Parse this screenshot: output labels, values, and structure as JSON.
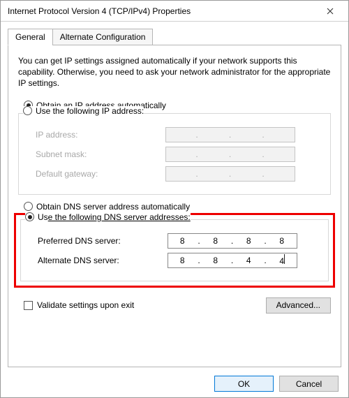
{
  "window": {
    "title": "Internet Protocol Version 4 (TCP/IPv4) Properties"
  },
  "tabs": {
    "general": "General",
    "alternate": "Alternate Configuration"
  },
  "intro": "You can get IP settings assigned automatically if your network supports this capability. Otherwise, you need to ask your network administrator for the appropriate IP settings.",
  "ip": {
    "auto_pre": "O",
    "auto_rest": "btain an IP address automatically",
    "manual_pre": "U",
    "manual_rest": "se the following IP address:",
    "address_pre": "I",
    "address_rest": "P address:",
    "subnet_pre": "S",
    "subnet_rest": "ubnet mask:",
    "gateway_pre": "D",
    "gateway_rest": "efault gateway:"
  },
  "ip_selected": "auto",
  "dns": {
    "auto_pre": "O",
    "auto_rest": "btain DNS server address automatically",
    "manual_pre": "Us",
    "manual_rest": "e the following DNS server addresses:",
    "preferred_pre": "P",
    "preferred_rest": "referred DNS server:",
    "alternate_pre": "A",
    "alternate_rest": "lternate DNS server:",
    "preferred": {
      "o1": "8",
      "o2": "8",
      "o3": "8",
      "o4": "8"
    },
    "alternate": {
      "o1": "8",
      "o2": "8",
      "o3": "4",
      "o4": "4"
    }
  },
  "dns_selected": "manual",
  "validate_pre": "V",
  "validate_rest": "alidate settings upon exit",
  "advanced_pre": "Ad",
  "advanced_rest": "vanced...",
  "buttons": {
    "ok": "OK",
    "cancel": "Cancel"
  },
  "dot": "."
}
